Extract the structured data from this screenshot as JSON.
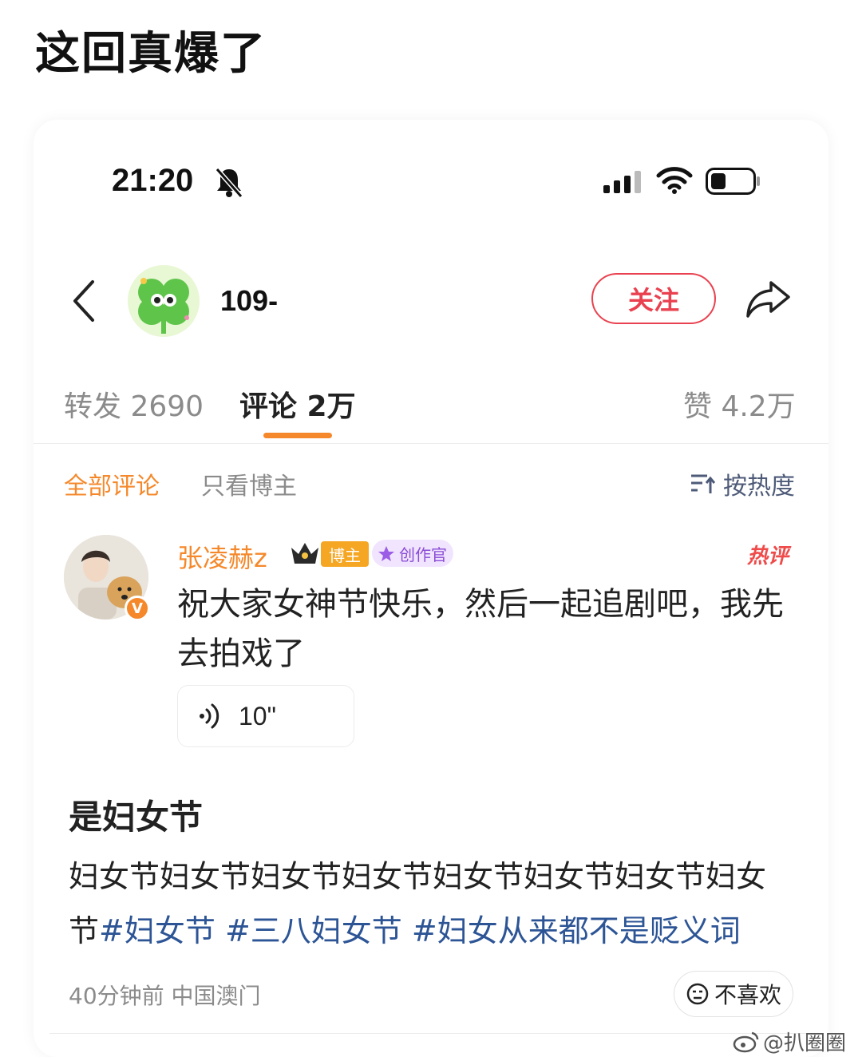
{
  "headline": "这回真爆了",
  "status_bar": {
    "time": "21:20",
    "icons": [
      "bell-muted-icon",
      "signal-icon",
      "wifi-icon",
      "battery-icon"
    ]
  },
  "nav": {
    "back_icon": "chevron-left-icon",
    "user_name": "109-",
    "follow_label": "关注",
    "share_icon": "share-arrow-icon"
  },
  "tabs": [
    {
      "label": "转发 2690",
      "active": false
    },
    {
      "label": "评论 2万",
      "active": true
    },
    {
      "label": "赞 4.2万",
      "active": false
    }
  ],
  "filters": {
    "all": "全部评论",
    "blogger_only": "只看博主",
    "sort": "按热度"
  },
  "comment": {
    "user": "张凌赫z",
    "badge_blogger": "博主",
    "badge_creator": "创作官",
    "hot_tag": "热评",
    "text": "祝大家女神节快乐，然后一起追剧吧，我先去拍戏了",
    "voice_length": "10\""
  },
  "post": {
    "title": "是妇女节",
    "body_plain": "妇女节妇女节妇女节妇女节妇女节妇女节妇女节妇女节",
    "hashtags": [
      "#妇女节",
      "#三八妇女节",
      "#妇女从来都不是贬义词"
    ],
    "meta": "40分钟前 中国澳门",
    "dislike_label": "不喜欢"
  },
  "watermark": "@扒圈圈",
  "colors": {
    "accent_orange": "#f5882a",
    "follow_red": "#e9414f",
    "hashtag_blue": "#2d5596"
  }
}
